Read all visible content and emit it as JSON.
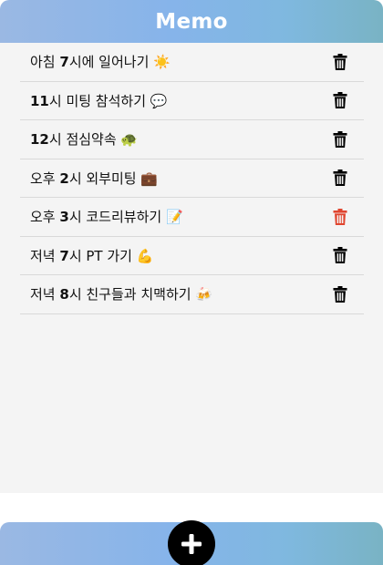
{
  "header": {
    "title": "Memo"
  },
  "items": [
    {
      "pre": "아침 ",
      "num": "7",
      "post": "시에 일어나기 ☀️",
      "trash_color": "#000000"
    },
    {
      "pre": "",
      "num": "11",
      "post": "시 미팅 참석하기 💬",
      "trash_color": "#000000"
    },
    {
      "pre": "",
      "num": "12",
      "post": "시 점심약속 🐢",
      "trash_color": "#000000"
    },
    {
      "pre": "오후 ",
      "num": "2",
      "post": "시 외부미팅 💼",
      "trash_color": "#000000"
    },
    {
      "pre": "오후 ",
      "num": "3",
      "post": "시 코드리뷰하기 📝",
      "trash_color": "#e0452f"
    },
    {
      "pre": "저녁 ",
      "num": "7",
      "post": "시 PT 가기 💪",
      "trash_color": "#000000"
    },
    {
      "pre": "저녁 ",
      "num": "8",
      "post": "시 친구들과 치맥하기 🍻",
      "trash_color": "#000000"
    }
  ],
  "colors": {
    "accent_gradient_start": "#9ab8e3",
    "accent_gradient_end": "#79b3c4",
    "delete_hover": "#e0452f"
  },
  "footer": {
    "add_icon": "plus-icon"
  }
}
